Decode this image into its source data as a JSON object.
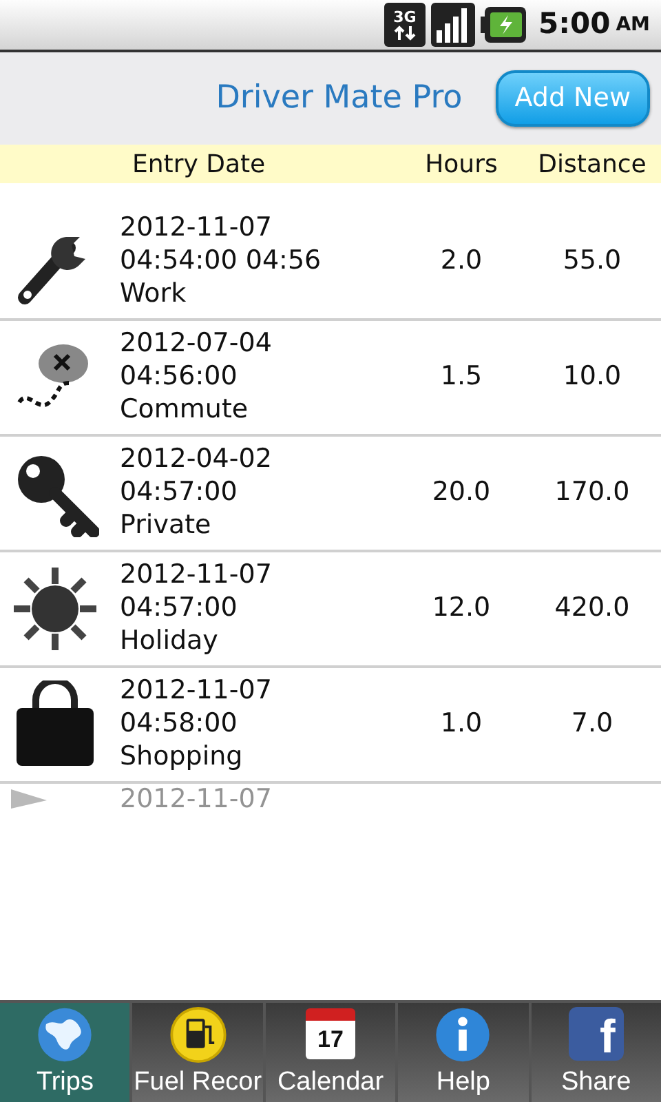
{
  "status_bar": {
    "network": "3G",
    "time": "5:00",
    "meridiem": "AM"
  },
  "header": {
    "title": "Driver Mate Pro",
    "button": "Add New"
  },
  "table": {
    "columns": [
      "Entry Date",
      "Hours",
      "Distance"
    ],
    "rows": [
      {
        "date": "2012-11-07",
        "time": "04:54:00 04:56",
        "category": "Work",
        "hours": "2.0",
        "distance": "55.0"
      },
      {
        "date": "2012-07-04",
        "time": "04:56:00",
        "category": "Commute",
        "hours": "1.5",
        "distance": "10.0"
      },
      {
        "date": "2012-04-02",
        "time": "04:57:00",
        "category": "Private",
        "hours": "20.0",
        "distance": "170.0"
      },
      {
        "date": "2012-11-07",
        "time": "04:57:00",
        "category": "Holiday",
        "hours": "12.0",
        "distance": "420.0"
      },
      {
        "date": "2012-11-07",
        "time": "04:58:00",
        "category": "Shopping",
        "hours": "1.0",
        "distance": "7.0"
      },
      {
        "date": "2012-11-07",
        "faded": true
      }
    ]
  },
  "tabs": [
    {
      "label": "Trips",
      "selected": true
    },
    {
      "label": "Fuel Recor",
      "selected": false
    },
    {
      "label": "Calendar",
      "selected": false,
      "icon_text": "17"
    },
    {
      "label": "Help",
      "selected": false
    },
    {
      "label": "Share",
      "selected": false,
      "icon_text": "f"
    }
  ]
}
